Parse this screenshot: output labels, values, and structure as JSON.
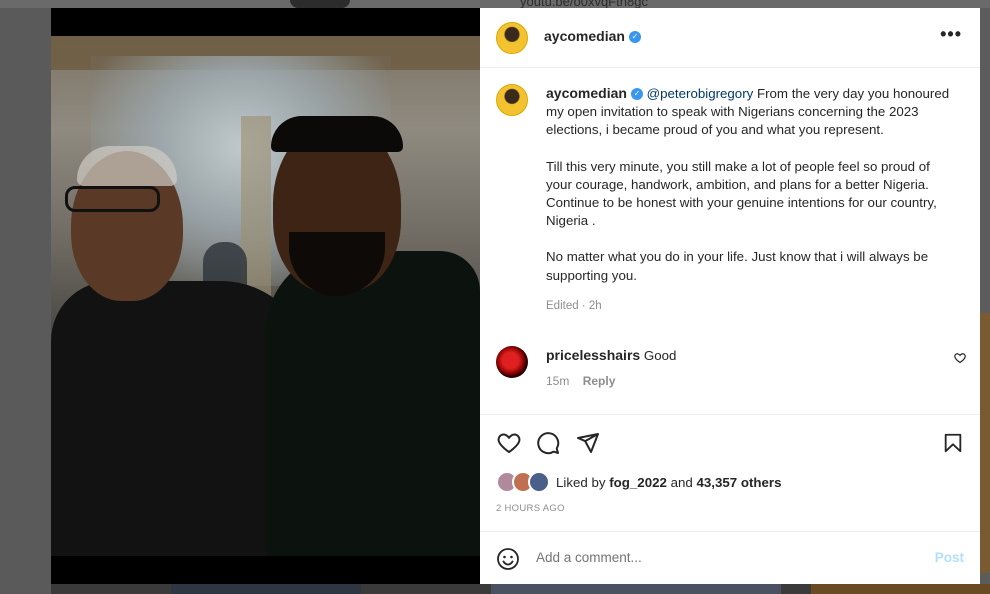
{
  "background": {
    "top_link_text": "youtu.be/o0xvqFth8gc"
  },
  "post": {
    "username": "aycomedian",
    "verified": true,
    "more_icon": "ellipsis-icon",
    "caption": {
      "username": "aycomedian",
      "mention": "@peterobigregory",
      "paragraph1": " From the very day you honoured my open invitation to speak with Nigerians concerning the 2023 elections, i became proud of you and what you represent.",
      "paragraph2": "Till this very minute, you still make a lot of people feel so proud of your courage, handwork, ambition, and plans for a better Nigeria. Continue to be honest with your genuine intentions for our country, Nigeria .",
      "paragraph3": "No matter what you do in your life. Just know that i will always be supporting you.",
      "meta": "Edited · 2h"
    },
    "comments": [
      {
        "username": "pricelesshairs",
        "text": "Good",
        "time": "15m",
        "reply_label": "Reply"
      }
    ],
    "likes": {
      "prefix": "Liked by ",
      "first_liker": "fog_2022",
      "joiner": " and ",
      "others": "43,357 others"
    },
    "timestamp": "2 HOURS AGO",
    "add_comment": {
      "placeholder": "Add a comment...",
      "post_label": "Post"
    }
  },
  "colors": {
    "accent_blue": "#0095f6",
    "post_button_disabled": "#b2dffc",
    "verified_badge": "#3897f0"
  }
}
